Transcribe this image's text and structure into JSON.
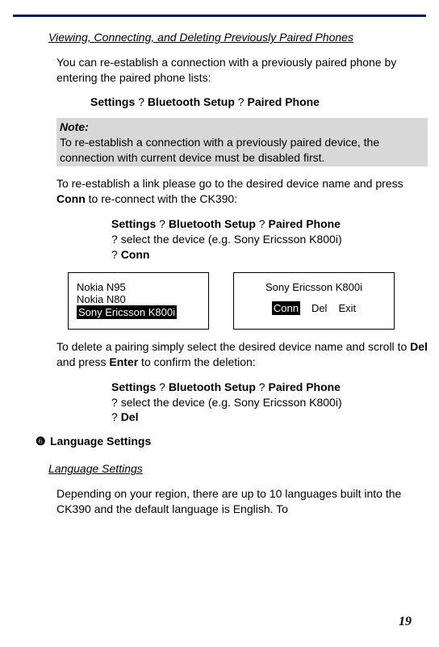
{
  "heading1": "Viewing, Connecting, and Deleting Previously Paired Phones",
  "para1": "You can re-establish a connection with a previously paired phone by entering the paired phone lists:",
  "nav1": {
    "a": "Settings",
    "q1": " ? ",
    "b": " Bluetooth Setup",
    "q2": " ? ",
    "c": " Paired Phone"
  },
  "note": {
    "title": "Note:",
    "body": "To re-establish a connection with a previously paired device, the connection with current device must be disabled first."
  },
  "para2_a": "To re-establish a link please go to the desired device name and press ",
  "para2_b": "Conn",
  "para2_c": " to re-connect with the CK390:",
  "steps1": {
    "line1_a": "Settings",
    "line1_q1": " ? ",
    "line1_b": " Bluetooth Setup",
    "line1_q2": " ? ",
    "line1_c": " Paired Phone",
    "line2_q": "? ",
    "line2_t": " select the device (e.g. Sony Ericsson K800i)",
    "line3_q": "? ",
    "line3_b": " Conn"
  },
  "figA": {
    "l1": "Nokia N95",
    "l2": "Nokia N80",
    "l3": "Sony Ericsson K800i"
  },
  "figB": {
    "title": "Sony Ericsson K800i",
    "b1": "Conn",
    "b2": "Del",
    "b3": "Exit"
  },
  "para3_a": "To delete a pairing simply select the desired device name and scroll to ",
  "para3_b": "Del",
  "para3_c": " and press ",
  "para3_d": "Enter",
  "para3_e": " to confirm the deletion:",
  "steps2": {
    "line1_a": "Settings",
    "line1_q1": " ? ",
    "line1_b": " Bluetooth Setup",
    "line1_q2": " ? ",
    "line1_c": " Paired Phone",
    "line2_q": "? ",
    "line2_t": " select the device (e.g. Sony Ericsson K800i)",
    "line3_q": "? ",
    "line3_b": " Del"
  },
  "sec_num": "❻",
  "sec_title": "Language Settings",
  "heading2": "Language Settings",
  "para4": "Depending on your region, there are up to 10 languages built into the CK390 and the default language is English. To",
  "pagenum": "19"
}
